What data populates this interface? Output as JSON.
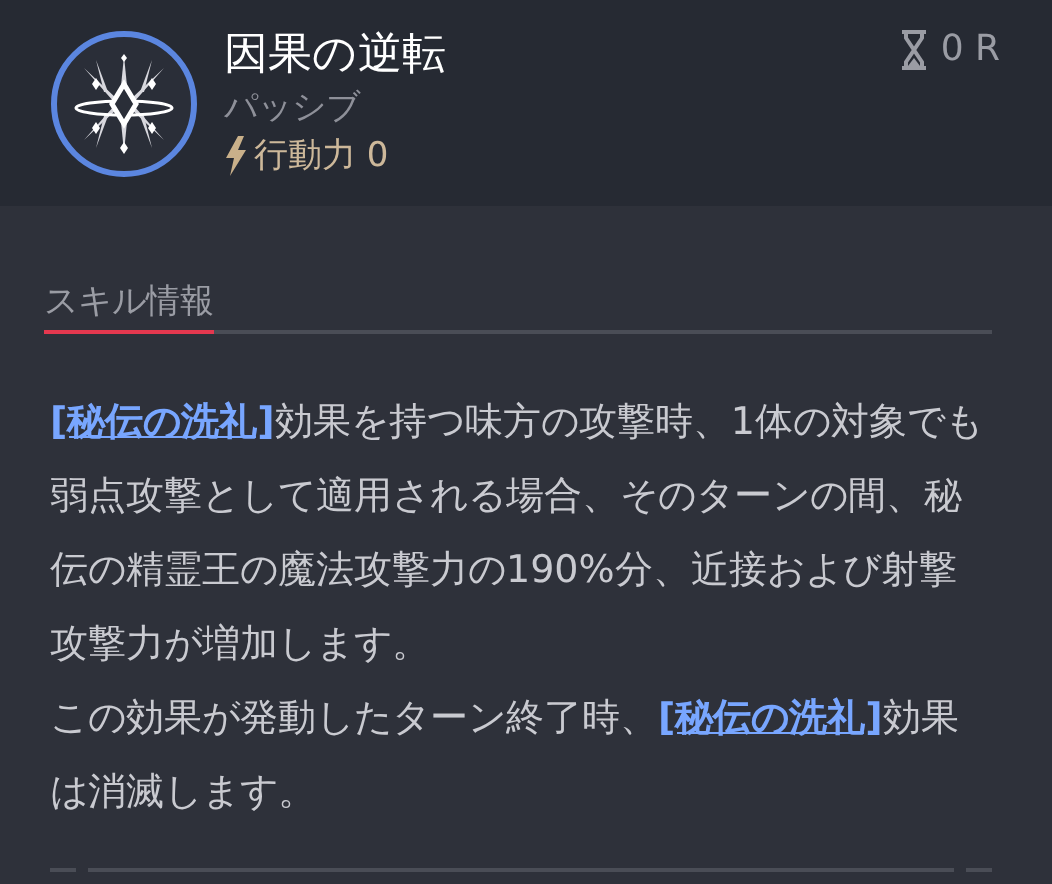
{
  "skill": {
    "title": "因果の逆転",
    "type": "パッシブ",
    "cost": "行動力 0",
    "cooldown": "0 R"
  },
  "section": {
    "label": "スキル情報",
    "selected": true
  },
  "description": [
    [
      {
        "kind": "link",
        "text": "[秘伝の洗礼]"
      },
      {
        "kind": "text",
        "text": "効果を持つ味方の攻撃時、1体の対象でも弱点攻撃として適用される場合、そのターンの間、秘伝の精霊王の魔法攻撃力の190%分、近接および射撃攻撃力が増加します。"
      }
    ],
    [
      {
        "kind": "text",
        "text": "この効果が発動したターン終了時、"
      },
      {
        "kind": "link",
        "text": "[秘伝の洗礼]"
      },
      {
        "kind": "text",
        "text": "効果は消滅します。"
      }
    ]
  ]
}
